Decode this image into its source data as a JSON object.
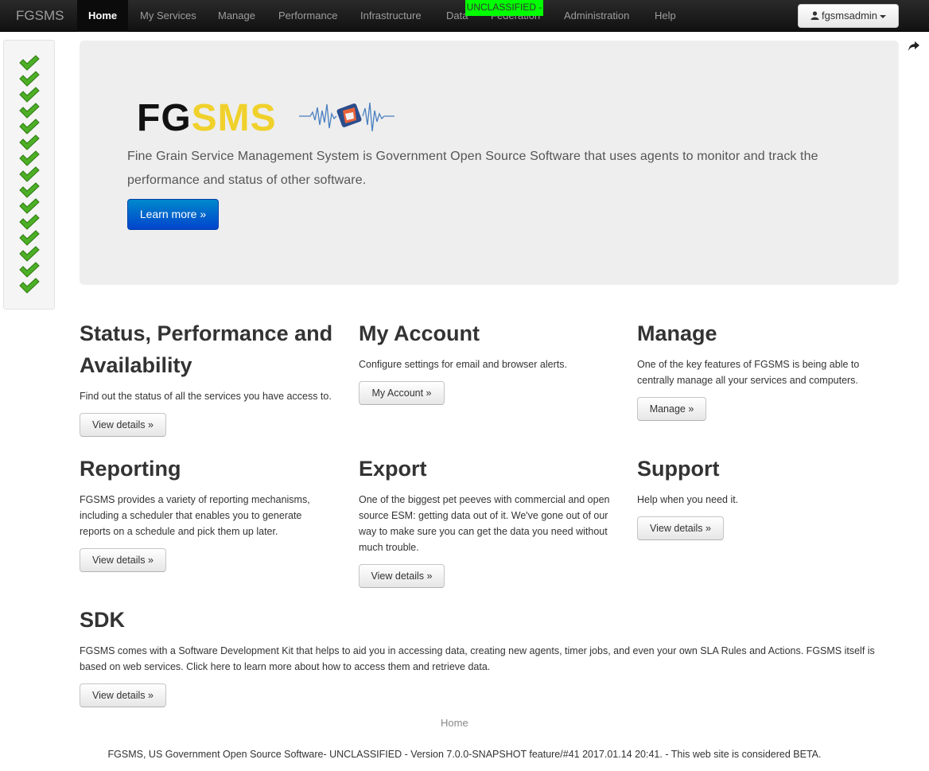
{
  "navbar": {
    "brand": "FGSMS",
    "items": [
      "Home",
      "My Services",
      "Manage",
      "Performance",
      "Infrastructure",
      "Data",
      "Federation",
      "Administration",
      "Help"
    ],
    "classification_banner": "UNCLASSIFIED -",
    "user_menu_label": "fgsmsadmin"
  },
  "status_panel": {
    "indicator_icon": "check-icon",
    "indicator_count": 15,
    "color": "#4caf25"
  },
  "hero": {
    "logo_part1": "FG",
    "logo_part2": "SMS",
    "description": "Fine Grain Service Management System is Government Open Source Software that uses agents to monitor and track the performance and status of other software.",
    "learn_more_label": "Learn more »"
  },
  "sections": {
    "status": {
      "title": "Status, Performance and Availability",
      "description": "Find out the status of all the services you have access to.",
      "button": "View details »"
    },
    "account": {
      "title": "My Account",
      "description": "Configure settings for email and browser alerts.",
      "button": "My Account »"
    },
    "manage": {
      "title": "Manage",
      "description": "One of the key features of FGSMS is being able to centrally manage all your services and computers.",
      "button": "Manage »"
    },
    "reporting": {
      "title": "Reporting",
      "description": "FGSMS provides a variety of reporting mechanisms, including a scheduler that enables you to generate reports on a schedule and pick them up later.",
      "button": "View details »"
    },
    "export": {
      "title": "Export",
      "description": "One of the biggest pet peeves with commercial and open source ESM: getting data out of it. We've gone out of our way to make sure you can get the data you need without much trouble.",
      "button": "View details »"
    },
    "support": {
      "title": "Support",
      "description": "Help when you need it.",
      "button": "View details »"
    },
    "sdk": {
      "title": "SDK",
      "description": "FGSMS comes with a Software Development Kit that helps to aid you in accessing data, creating new agents, timer jobs, and even your own SLA Rules and Actions. FGSMS itself is based on web services. Click here to learn more about how to access them and retrieve data.",
      "button": "View details »"
    }
  },
  "footer": {
    "home_link": "Home",
    "text": "FGSMS, US Government Open Source Software- UNCLASSIFIED - Version 7.0.0-SNAPSHOT feature/#41 2017.01.14 20:41. - This web site is considered BETA."
  }
}
